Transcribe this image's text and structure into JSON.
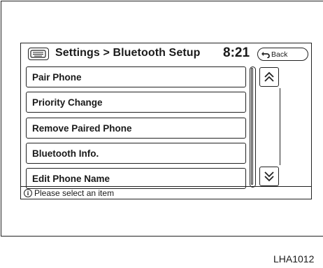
{
  "header": {
    "title": "Settings > Bluetooth Setup",
    "clock": "8:21",
    "back_label": "Back",
    "keyboard_icon": "keyboard-icon",
    "back_icon": "back-arrow-icon"
  },
  "menu": {
    "items": [
      {
        "label": "Pair Phone"
      },
      {
        "label": "Priority Change"
      },
      {
        "label": "Remove Paired Phone"
      },
      {
        "label": "Bluetooth Info."
      },
      {
        "label": "Edit Phone Name"
      }
    ]
  },
  "scroll": {
    "up_icon": "scroll-up-double-chevron-icon",
    "down_icon": "scroll-down-double-chevron-icon"
  },
  "status": {
    "icon": "info-icon",
    "icon_glyph": "i",
    "message": "Please select an item"
  },
  "figure_id": "LHA1012",
  "colors": {
    "line": "#222222",
    "background": "#ffffff"
  }
}
